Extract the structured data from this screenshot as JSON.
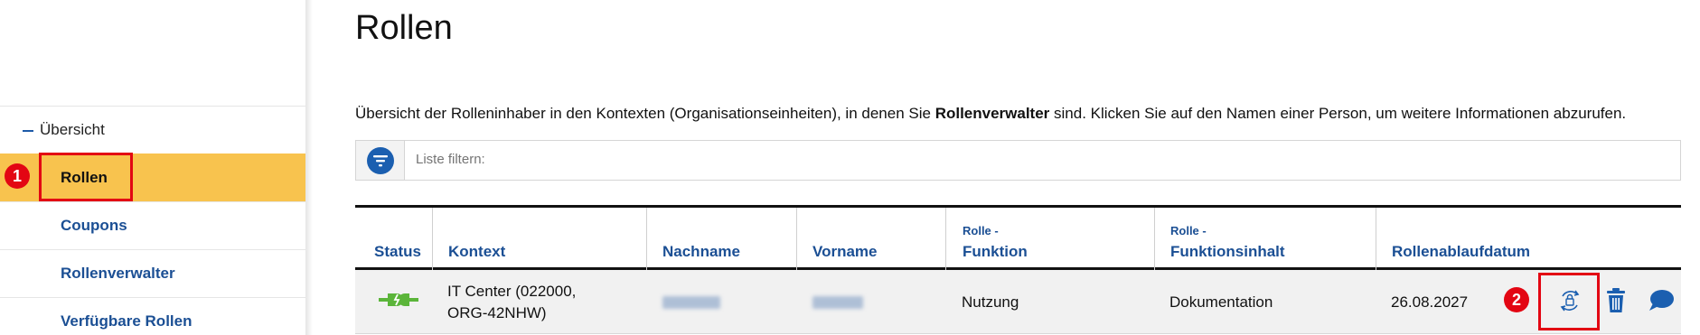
{
  "sidebar": {
    "parent_label": "Übersicht",
    "items": [
      {
        "label": "Rollen",
        "active": true
      },
      {
        "label": "Coupons",
        "active": false
      },
      {
        "label": "Rollenverwalter",
        "active": false
      },
      {
        "label": "Verfügbare Rollen",
        "active": false
      }
    ]
  },
  "annotations": {
    "badge_1": "1",
    "badge_2": "2",
    "highlight_color": "#e30613"
  },
  "page": {
    "title": "Rollen",
    "intro_part1": "Übersicht der Rolleninhaber in den Kontexten (Organisationseinheiten), in denen Sie ",
    "intro_bold": "Rollenverwalter",
    "intro_part2": " sind. Klicken Sie auf den Namen einer Person, um weitere Informationen abzurufen."
  },
  "filter": {
    "placeholder": "Liste filtern:",
    "icon": "filter-icon"
  },
  "table": {
    "headers": {
      "status": "Status",
      "kontext": "Kontext",
      "nachname": "Nachname",
      "vorname": "Vorname",
      "funktion_pre": "Rolle -",
      "funktion": "Funktion",
      "inhalt_pre": "Rolle -",
      "inhalt": "Funktionsinhalt",
      "ablauf": "Rollenablaufdatum"
    },
    "rows": [
      {
        "status_icon": "plug-connected-icon",
        "kontext_line1": "IT Center (022000,",
        "kontext_line2": "ORG-42NHW)",
        "nachname": "",
        "vorname": "",
        "funktion": "Nutzung",
        "inhalt": "Dokumentation",
        "ablauf": "26.08.2027",
        "actions": [
          "renew-role-icon",
          "trash-icon",
          "comment-icon"
        ]
      }
    ]
  },
  "colors": {
    "accent_blue": "#1b4f94",
    "active_bg": "#f8c34e",
    "status_green": "#5bb53a",
    "row_bg": "#f1f1f1"
  }
}
